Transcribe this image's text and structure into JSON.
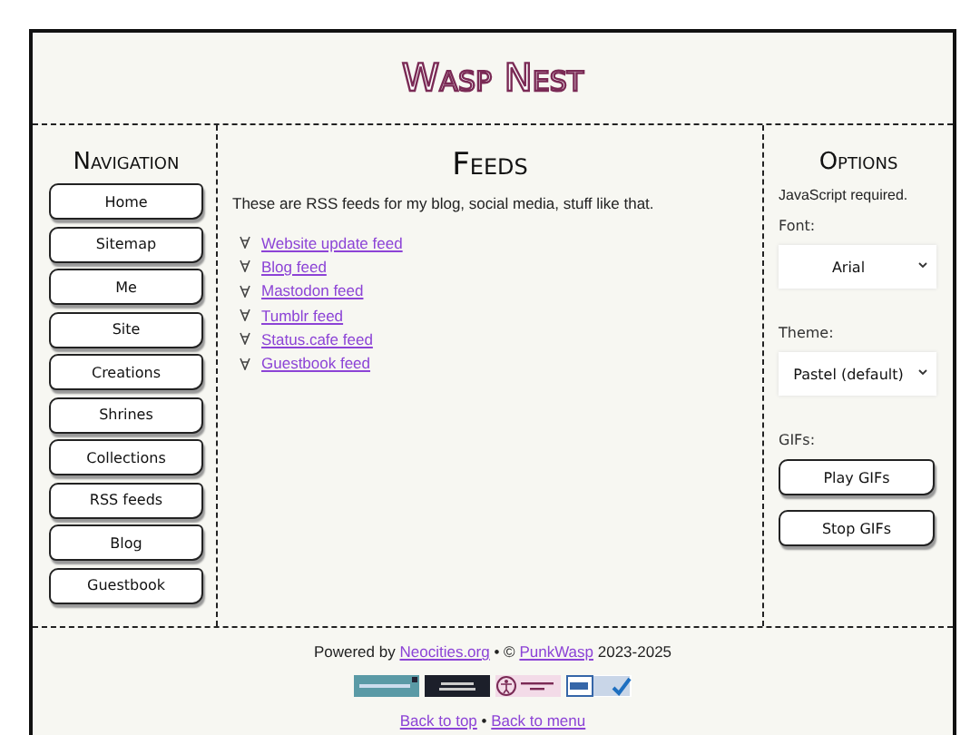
{
  "header": {
    "title": "Wasp Nest"
  },
  "navigation": {
    "heading": "Navigation",
    "items": [
      {
        "label": "Home"
      },
      {
        "label": "Sitemap"
      },
      {
        "label": "Me"
      },
      {
        "label": "Site"
      },
      {
        "label": "Creations"
      },
      {
        "label": "Shrines"
      },
      {
        "label": "Collections"
      },
      {
        "label": "RSS feeds"
      },
      {
        "label": "Blog"
      },
      {
        "label": "Guestbook"
      }
    ]
  },
  "feeds": {
    "heading": "Feeds",
    "intro": "These are RSS feeds for my blog, social media, stuff like that.",
    "links": [
      {
        "label": "Website update feed"
      },
      {
        "label": "Blog feed"
      },
      {
        "label": "Mastodon feed"
      },
      {
        "label": "Tumblr feed"
      },
      {
        "label": "Status.cafe feed"
      },
      {
        "label": "Guestbook feed"
      }
    ]
  },
  "options": {
    "heading": "Options",
    "note": "JavaScript required.",
    "font": {
      "label": "Font:",
      "value": "Arial"
    },
    "theme": {
      "label": "Theme:",
      "value": "Pastel (default)"
    },
    "gifs": {
      "label": "GIFs:",
      "buttons": [
        "Play GIFs",
        "Stop GIFs"
      ]
    }
  },
  "footer": {
    "credit": [
      {
        "kind": "text",
        "text": "Powered by"
      },
      {
        "kind": "link",
        "text": "Neocities.org"
      },
      {
        "kind": "text",
        "text": "• ©"
      },
      {
        "kind": "link",
        "text": "PunkWasp"
      },
      {
        "kind": "text",
        "text": "2023-2025"
      }
    ],
    "links": [
      {
        "kind": "link",
        "text": "Back to top"
      },
      {
        "kind": "text",
        "text": "•"
      },
      {
        "kind": "link",
        "text": "Back to menu"
      }
    ]
  }
}
